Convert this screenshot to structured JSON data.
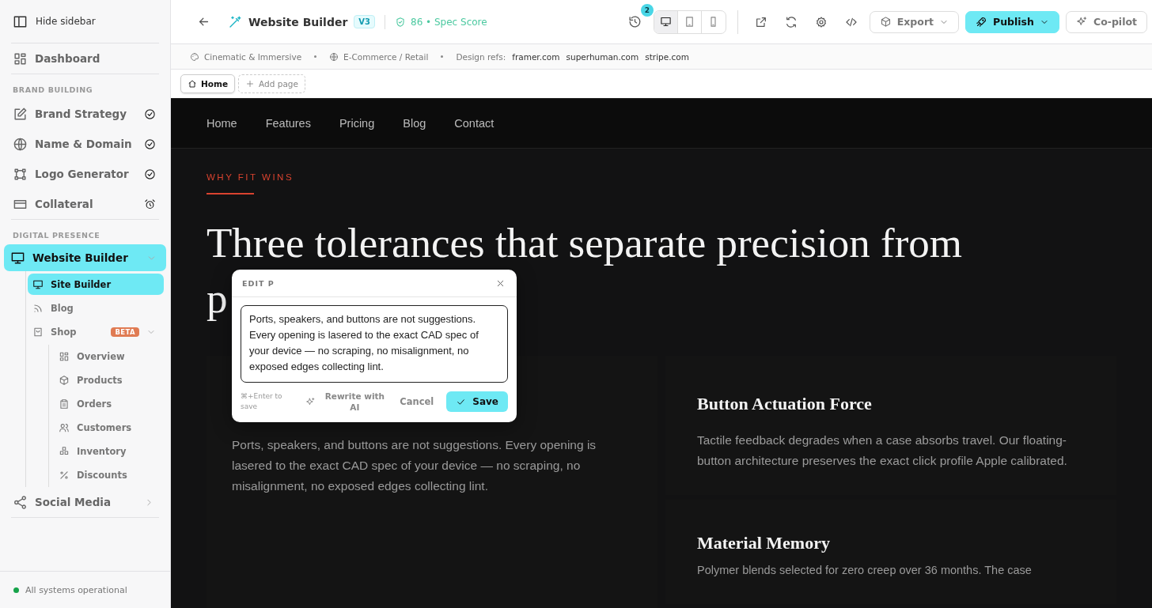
{
  "sidebar": {
    "hide_label": "Hide sidebar",
    "dashboard": {
      "label": "Dashboard",
      "selected": false
    },
    "sections": [
      {
        "title": "BRAND BUILDING",
        "items": [
          {
            "label": "Brand Strategy",
            "selected": false,
            "done": true
          },
          {
            "label": "Name & Domain",
            "selected": false,
            "done": true
          },
          {
            "label": "Logo Generator",
            "selected": false,
            "done": true
          },
          {
            "label": "Collateral",
            "selected": false,
            "done": false
          }
        ]
      },
      {
        "title": "DIGITAL PRESENCE",
        "items": [
          {
            "label": "Website Builder",
            "selected": true,
            "expanded": true,
            "children": [
              {
                "label": "Site Builder",
                "selected": true
              },
              {
                "label": "Blog",
                "selected": false
              },
              {
                "label": "Shop",
                "selected": false,
                "badge": "BETA",
                "expanded": true,
                "children": [
                  {
                    "label": "Overview",
                    "selected": false
                  },
                  {
                    "label": "Products",
                    "selected": false
                  },
                  {
                    "label": "Orders",
                    "selected": false
                  },
                  {
                    "label": "Customers",
                    "selected": false
                  },
                  {
                    "label": "Inventory",
                    "selected": false
                  },
                  {
                    "label": "Discounts",
                    "selected": false
                  }
                ]
              }
            ]
          },
          {
            "label": "Social Media",
            "selected": false,
            "expanded": false
          }
        ]
      }
    ],
    "status": {
      "text": "All systems operational",
      "color": "#16a34a"
    }
  },
  "topbar": {
    "title": "Website Builder",
    "version": "V3",
    "score": "86 • Spec Score",
    "history_count": "2",
    "devices": [
      {
        "selected": true
      },
      {
        "selected": false
      },
      {
        "selected": false
      }
    ],
    "export": "Export",
    "publish": "Publish",
    "copilot": "Co-pilot"
  },
  "meta": {
    "style": "Cinematic & Immersive",
    "industry": "E-Commerce / Retail",
    "refs_label": "Design refs:",
    "refs": [
      "framer.com",
      "superhuman.com",
      "stripe.com"
    ]
  },
  "page_tabs": [
    {
      "label": "Home",
      "selected": true
    }
  ],
  "add_page": "Add page",
  "preview": {
    "nav": [
      "Home",
      "Features",
      "Pricing",
      "Blog",
      "Contact"
    ],
    "eyebrow": "WHY FIT WINS",
    "headline_lines": [
      "Three tolerances that separate precision from",
      "p"
    ],
    "left_card": {
      "text": "Ports, speakers, and buttons are not suggestions. Every opening is lasered to the exact CAD spec of your device — no scraping, no misalignment, no exposed edges collecting lint."
    },
    "right_cards": [
      {
        "title": "Button Actuation Force",
        "text": "Tactile feedback degrades when a case absorbs travel. Our floating-button architecture preserves the exact click profile Apple calibrated."
      },
      {
        "title": "Material Memory",
        "text": "Polymer blends selected for zero creep over 36 months. The case"
      }
    ]
  },
  "editor": {
    "title": "EDIT P",
    "value": "Ports, speakers, and buttons are not suggestions. Every opening is lasered to the exact CAD spec of your device — no scraping, no misalignment, no exposed edges collecting lint.",
    "hint": "⌘+Enter to save",
    "rewrite": "Rewrite with AI",
    "cancel": "Cancel",
    "save": "Save"
  }
}
